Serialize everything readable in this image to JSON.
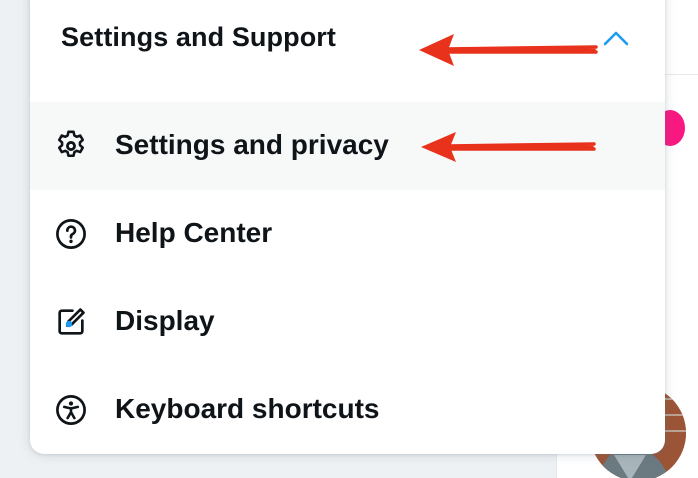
{
  "menu": {
    "section_title": "Settings and Support",
    "items": [
      {
        "label": "Settings and privacy",
        "icon": "gear-icon",
        "active": true
      },
      {
        "label": "Help Center",
        "icon": "help-circle-icon",
        "active": false
      },
      {
        "label": "Display",
        "icon": "display-edit-icon",
        "active": false
      },
      {
        "label": "Keyboard shortcuts",
        "icon": "accessibility-icon",
        "active": false
      }
    ]
  },
  "colors": {
    "accent": "#1d9bf0",
    "text": "#0f1419",
    "annotation": "#e8321c",
    "like_pink": "#f91880"
  }
}
